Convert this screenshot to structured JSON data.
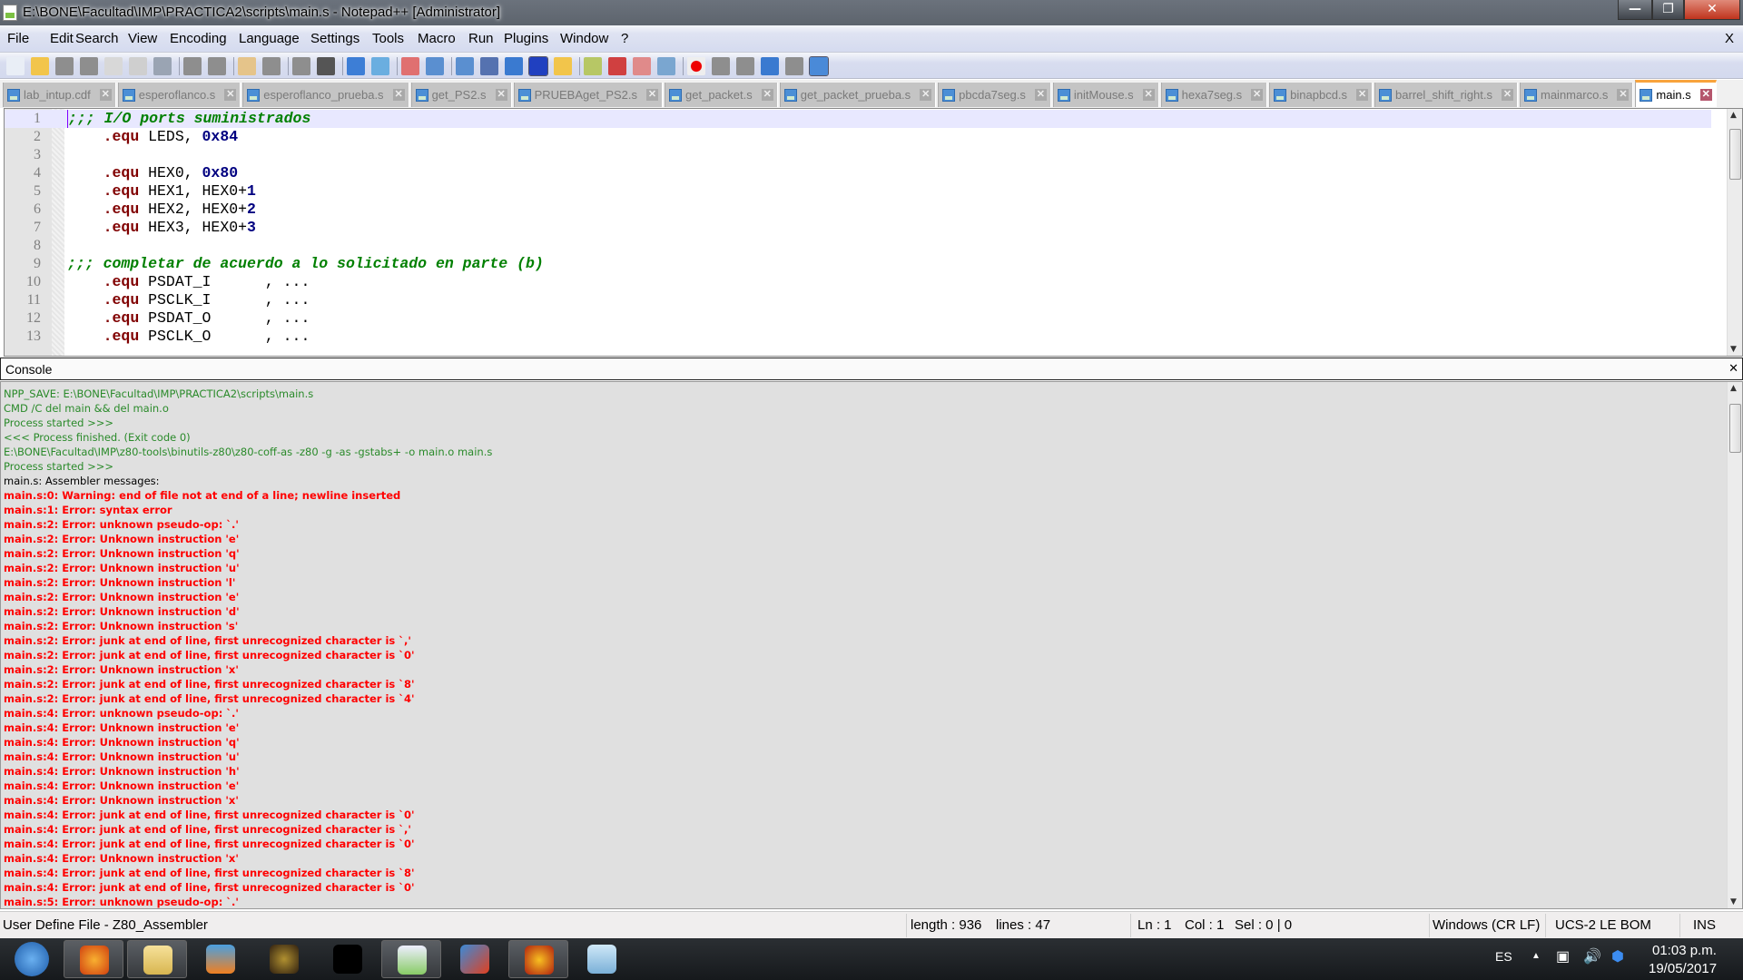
{
  "window": {
    "title": "E:\\BONE\\Facultad\\IMP\\PRACTICA2\\scripts\\main.s - Notepad++ [Administrator]",
    "minimize": "—",
    "maximize": "❐",
    "close": "✕"
  },
  "menu": {
    "items": [
      "File",
      "Edit",
      "Search",
      "View",
      "Encoding",
      "Language",
      "Settings",
      "Tools",
      "Macro",
      "Run",
      "Plugins",
      "Window",
      "?"
    ],
    "close": "X"
  },
  "toolbar": {
    "buttons": [
      "new-file",
      "open-file",
      "save",
      "save-all",
      "close",
      "close-all",
      "print",
      "cut",
      "copy",
      "paste",
      "undo",
      "redo",
      "find",
      "replace",
      "zoom-in",
      "zoom-out",
      "sync-vertical",
      "sync-horizontal",
      "word-wrap",
      "show-all-chars",
      "indent-guide",
      "user-defined-language",
      "document-map",
      "function-list",
      "folder-as-workspace",
      "monitoring",
      "record-macro",
      "stop-recording",
      "playback-macro",
      "run-macro-multiple",
      "save-macro",
      "console"
    ]
  },
  "tabs": [
    {
      "label": "lab_intup.cdf"
    },
    {
      "label": "esperoflanco.s"
    },
    {
      "label": "esperoflanco_prueba.s"
    },
    {
      "label": "get_PS2.s"
    },
    {
      "label": "PRUEBAget_PS2.s"
    },
    {
      "label": "get_packet.s"
    },
    {
      "label": "get_packet_prueba.s"
    },
    {
      "label": "pbcda7seg.s"
    },
    {
      "label": "initMouse.s"
    },
    {
      "label": "hexa7seg.s"
    },
    {
      "label": "binapbcd.s"
    },
    {
      "label": "barrel_shift_right.s"
    },
    {
      "label": "mainmarco.s"
    },
    {
      "label": "main.s",
      "active": true
    }
  ],
  "editor": {
    "lines": [
      {
        "n": "1",
        "seg": [
          {
            "k": "cm",
            "t": ";;; I/O ports suministrados"
          }
        ]
      },
      {
        "n": "2",
        "seg": [
          {
            "k": "tx",
            "t": "    "
          },
          {
            "k": "kw",
            "t": ".equ"
          },
          {
            "k": "tx",
            "t": " LEDS, "
          },
          {
            "k": "num",
            "t": "0x84"
          }
        ]
      },
      {
        "n": "3",
        "seg": []
      },
      {
        "n": "4",
        "seg": [
          {
            "k": "tx",
            "t": "    "
          },
          {
            "k": "kw",
            "t": ".equ"
          },
          {
            "k": "tx",
            "t": " HEX0, "
          },
          {
            "k": "num",
            "t": "0x80"
          }
        ]
      },
      {
        "n": "5",
        "seg": [
          {
            "k": "tx",
            "t": "    "
          },
          {
            "k": "kw",
            "t": ".equ"
          },
          {
            "k": "tx",
            "t": " HEX1, HEX0+"
          },
          {
            "k": "num",
            "t": "1"
          }
        ]
      },
      {
        "n": "6",
        "seg": [
          {
            "k": "tx",
            "t": "    "
          },
          {
            "k": "kw",
            "t": ".equ"
          },
          {
            "k": "tx",
            "t": " HEX2, HEX0+"
          },
          {
            "k": "num",
            "t": "2"
          }
        ]
      },
      {
        "n": "7",
        "seg": [
          {
            "k": "tx",
            "t": "    "
          },
          {
            "k": "kw",
            "t": ".equ"
          },
          {
            "k": "tx",
            "t": " HEX3, HEX0+"
          },
          {
            "k": "num",
            "t": "3"
          }
        ]
      },
      {
        "n": "8",
        "seg": []
      },
      {
        "n": "9",
        "seg": [
          {
            "k": "cm",
            "t": ";;; completar de acuerdo a lo solicitado en parte (b)"
          }
        ]
      },
      {
        "n": "10",
        "seg": [
          {
            "k": "tx",
            "t": "    "
          },
          {
            "k": "kw",
            "t": ".equ"
          },
          {
            "k": "tx",
            "t": " PSDAT_I      , ..."
          }
        ]
      },
      {
        "n": "11",
        "seg": [
          {
            "k": "tx",
            "t": "    "
          },
          {
            "k": "kw",
            "t": ".equ"
          },
          {
            "k": "tx",
            "t": " PSCLK_I      , ..."
          }
        ]
      },
      {
        "n": "12",
        "seg": [
          {
            "k": "tx",
            "t": "    "
          },
          {
            "k": "kw",
            "t": ".equ"
          },
          {
            "k": "tx",
            "t": " PSDAT_O      , ..."
          }
        ]
      },
      {
        "n": "13",
        "seg": [
          {
            "k": "tx",
            "t": "    "
          },
          {
            "k": "kw",
            "t": ".equ"
          },
          {
            "k": "tx",
            "t": " PSCLK_O      , ..."
          }
        ]
      }
    ]
  },
  "console": {
    "title": "Console",
    "close": "✕",
    "lines": [
      {
        "k": "info",
        "t": "NPP_SAVE: E:\\BONE\\Facultad\\IMP\\PRACTICA2\\scripts\\main.s"
      },
      {
        "k": "info",
        "t": "CMD /C del main && del main.o"
      },
      {
        "k": "info",
        "t": "Process started >>>"
      },
      {
        "k": "info",
        "t": "<<< Process finished. (Exit code 0)"
      },
      {
        "k": "info",
        "t": "E:\\BONE\\Facultad\\IMP\\z80-tools\\binutils-z80\\z80-coff-as -z80 -g -as -gstabs+ -o main.o main.s"
      },
      {
        "k": "info",
        "t": "Process started >>>"
      },
      {
        "k": "plain",
        "t": "main.s: Assembler messages:"
      },
      {
        "k": "err",
        "t": "main.s:0: Warning: end of file not at end of a line; newline inserted"
      },
      {
        "k": "err",
        "t": "main.s:1: Error: syntax error"
      },
      {
        "k": "err",
        "t": "main.s:2: Error: unknown pseudo-op: `.'"
      },
      {
        "k": "err",
        "t": "main.s:2: Error: Unknown instruction 'e'"
      },
      {
        "k": "err",
        "t": "main.s:2: Error: Unknown instruction 'q'"
      },
      {
        "k": "err",
        "t": "main.s:2: Error: Unknown instruction 'u'"
      },
      {
        "k": "err",
        "t": "main.s:2: Error: Unknown instruction 'l'"
      },
      {
        "k": "err",
        "t": "main.s:2: Error: Unknown instruction 'e'"
      },
      {
        "k": "err",
        "t": "main.s:2: Error: Unknown instruction 'd'"
      },
      {
        "k": "err",
        "t": "main.s:2: Error: Unknown instruction 's'"
      },
      {
        "k": "err",
        "t": "main.s:2: Error: junk at end of line, first unrecognized character is `,'"
      },
      {
        "k": "err",
        "t": "main.s:2: Error: junk at end of line, first unrecognized character is `0'"
      },
      {
        "k": "err",
        "t": "main.s:2: Error: Unknown instruction 'x'"
      },
      {
        "k": "err",
        "t": "main.s:2: Error: junk at end of line, first unrecognized character is `8'"
      },
      {
        "k": "err",
        "t": "main.s:2: Error: junk at end of line, first unrecognized character is `4'"
      },
      {
        "k": "err",
        "t": "main.s:4: Error: unknown pseudo-op: `.'"
      },
      {
        "k": "err",
        "t": "main.s:4: Error: Unknown instruction 'e'"
      },
      {
        "k": "err",
        "t": "main.s:4: Error: Unknown instruction 'q'"
      },
      {
        "k": "err",
        "t": "main.s:4: Error: Unknown instruction 'u'"
      },
      {
        "k": "err",
        "t": "main.s:4: Error: Unknown instruction 'h'"
      },
      {
        "k": "err",
        "t": "main.s:4: Error: Unknown instruction 'e'"
      },
      {
        "k": "err",
        "t": "main.s:4: Error: Unknown instruction 'x'"
      },
      {
        "k": "err",
        "t": "main.s:4: Error: junk at end of line, first unrecognized character is `0'"
      },
      {
        "k": "err",
        "t": "main.s:4: Error: junk at end of line, first unrecognized character is `,'"
      },
      {
        "k": "err",
        "t": "main.s:4: Error: junk at end of line, first unrecognized character is `0'"
      },
      {
        "k": "err",
        "t": "main.s:4: Error: Unknown instruction 'x'"
      },
      {
        "k": "err",
        "t": "main.s:4: Error: junk at end of line, first unrecognized character is `8'"
      },
      {
        "k": "err",
        "t": "main.s:4: Error: junk at end of line, first unrecognized character is `0'"
      },
      {
        "k": "err",
        "t": "main.s:5: Error: unknown pseudo-op: `.'"
      }
    ]
  },
  "statusbar": {
    "filetype": "User Define File - Z80_Assembler",
    "length": "length : 936",
    "lines": "lines : 47",
    "ln": "Ln : 1",
    "col": "Col : 1",
    "sel": "Sel : 0 | 0",
    "eol": "Windows (CR LF)",
    "encoding": "UCS-2 LE BOM",
    "mode": "INS"
  },
  "taskbar": {
    "apps": [
      "start",
      "firefox",
      "file-explorer",
      "media-player",
      "dark-souls",
      "skyrim",
      "notepad-plus-plus",
      "matlab",
      "borderlands-2",
      "notepad"
    ],
    "tray": {
      "lang": "ES",
      "time": "01:03 p.m.",
      "date": "19/05/2017"
    }
  },
  "colors": {
    "error": "#ff0000",
    "info": "#2a8a2a",
    "active_tab_accent": "#f8a33c",
    "keyword": "#800000",
    "number": "#000080",
    "comment": "#008000"
  }
}
